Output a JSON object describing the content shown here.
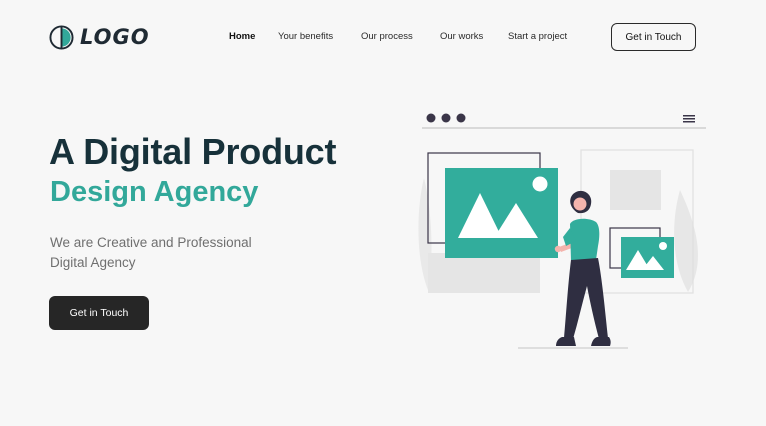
{
  "header": {
    "logo_text": "LOGO",
    "nav": [
      {
        "label": "Home",
        "active": true
      },
      {
        "label": "Your benefits",
        "active": false
      },
      {
        "label": "Our process",
        "active": false
      },
      {
        "label": "Our works",
        "active": false
      },
      {
        "label": "Start a project",
        "active": false
      }
    ],
    "cta_label": "Get in Touch"
  },
  "hero": {
    "title_line1": "A Digital Product",
    "title_line2": "Design Agency",
    "subtitle_line1": "We are Creative and Professional",
    "subtitle_line2": "Digital Agency",
    "cta_label": "Get in Touch"
  },
  "colors": {
    "accent": "#32a89a",
    "heading_dark": "#17313a",
    "button_dark": "#262626",
    "background": "#f7f7f7"
  },
  "illustration": {
    "icon": "image-gallery-person-illustration"
  }
}
